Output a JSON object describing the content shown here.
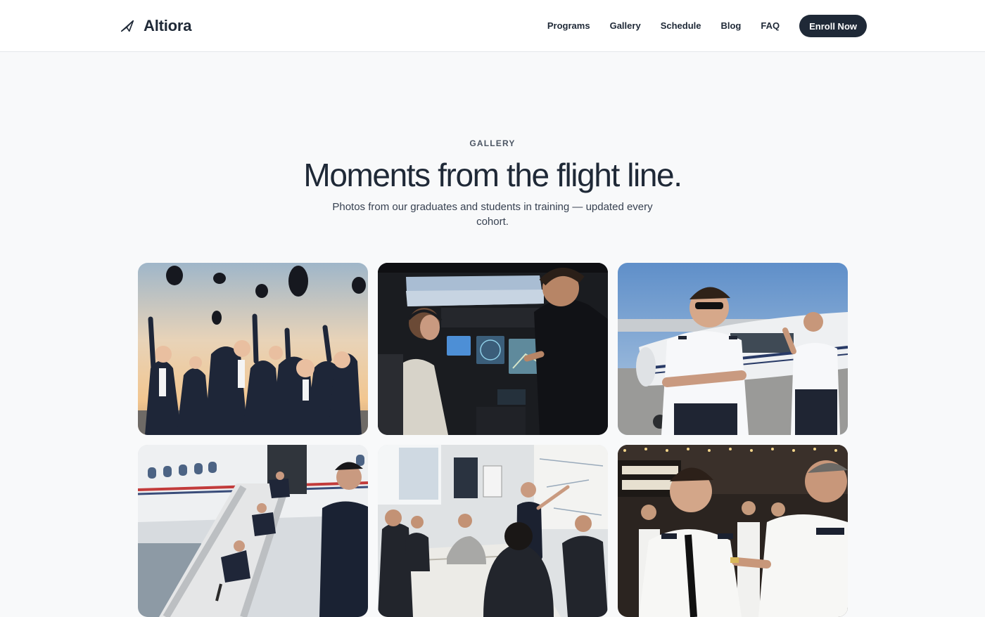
{
  "header": {
    "brand_name": "Altiora",
    "brand_icon": "paper-plane-icon",
    "nav": [
      {
        "label": "Programs"
      },
      {
        "label": "Gallery"
      },
      {
        "label": "Schedule"
      },
      {
        "label": "Blog"
      },
      {
        "label": "FAQ"
      }
    ],
    "cta_label": "Enroll Now"
  },
  "gallery": {
    "eyebrow": "GALLERY",
    "title": "Moments from the flight line.",
    "subtitle": "Photos from our graduates and students in training — updated every cohort.",
    "photos": [
      {
        "name": "graduation-cap-toss-photo"
      },
      {
        "name": "flight-simulator-training-photo"
      },
      {
        "name": "pilots-with-aircraft-photo"
      },
      {
        "name": "evacuation-slide-training-photo"
      },
      {
        "name": "ground-school-classroom-photo"
      },
      {
        "name": "wings-pinning-ceremony-photo"
      }
    ]
  },
  "colors": {
    "accent": "#1f2937",
    "background": "#f8f9fa",
    "header_bg": "#ffffff"
  }
}
